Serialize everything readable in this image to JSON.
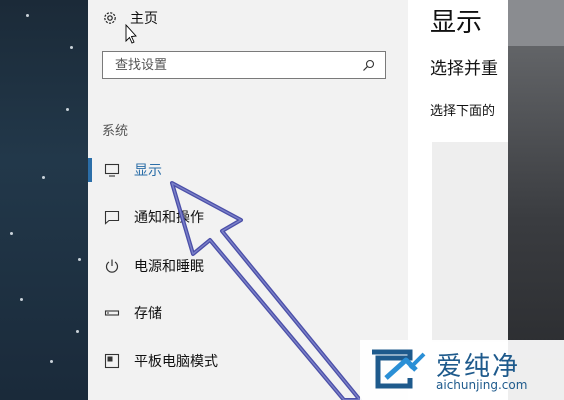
{
  "nav": {
    "home_label": "主页",
    "search_placeholder": "查找设置",
    "section_label": "系统",
    "items": [
      {
        "label": "显示",
        "icon": "monitor-icon",
        "active": true
      },
      {
        "label": "通知和操作",
        "icon": "notification-icon",
        "active": false
      },
      {
        "label": "电源和睡眠",
        "icon": "power-icon",
        "active": false
      },
      {
        "label": "存储",
        "icon": "storage-icon",
        "active": false
      },
      {
        "label": "平板电脑模式",
        "icon": "tablet-mode-icon",
        "active": false
      }
    ]
  },
  "content": {
    "title": "显示",
    "subtitle": "选择并重",
    "description": "选择下面的"
  },
  "watermark": {
    "brand": "爱纯净",
    "url": "aichunjing.com"
  },
  "colors": {
    "accent": "#2b6ea8",
    "nav_bg": "#f2f2f2",
    "arrow": "#4b4fa8"
  }
}
